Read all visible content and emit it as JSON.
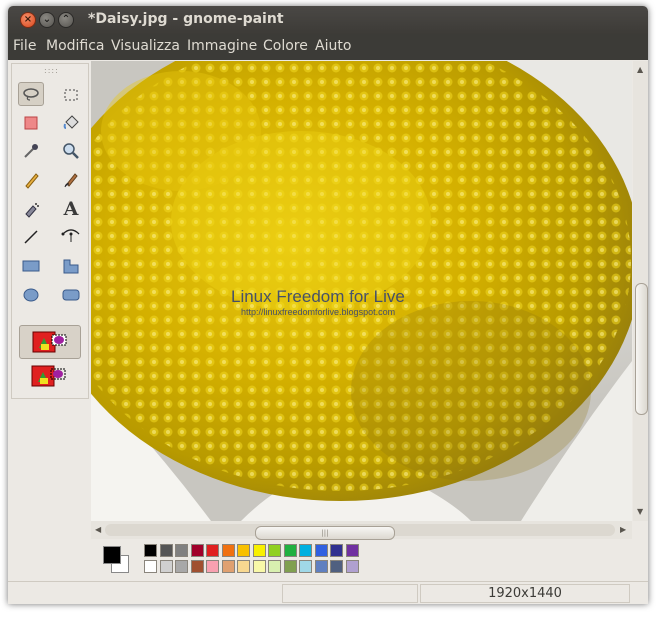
{
  "window": {
    "title": "*Daisy.jpg - gnome-paint",
    "buttons": {
      "close": "×",
      "minimize": "⌄",
      "maximize": "⌃"
    }
  },
  "menu": [
    "File",
    "Modifica",
    "Visualizza",
    "Immagine",
    "Colore",
    "Aiuto"
  ],
  "tools": [
    {
      "name": "lasso-select-icon",
      "glyph": "⟳",
      "active": true
    },
    {
      "name": "rect-select-icon",
      "glyph": "⬚"
    },
    {
      "name": "eraser-icon",
      "glyph": "■"
    },
    {
      "name": "fill-bucket-icon",
      "glyph": "⛾"
    },
    {
      "name": "color-picker-icon",
      "glyph": "✎"
    },
    {
      "name": "zoom-icon",
      "glyph": "⌕"
    },
    {
      "name": "pencil-icon",
      "glyph": "✏"
    },
    {
      "name": "paintbrush-icon",
      "glyph": "🖌"
    },
    {
      "name": "airbrush-icon",
      "glyph": "✒"
    },
    {
      "name": "text-icon",
      "glyph": "A"
    },
    {
      "name": "line-icon",
      "glyph": "╱"
    },
    {
      "name": "curve-icon",
      "glyph": "⤻"
    },
    {
      "name": "rectangle-icon",
      "glyph": "▬"
    },
    {
      "name": "polygon-icon",
      "glyph": "⬒"
    },
    {
      "name": "ellipse-icon",
      "glyph": "⬬"
    },
    {
      "name": "rounded-rect-icon",
      "glyph": "▭"
    }
  ],
  "canvas": {
    "watermark_title": "Linux Freedom for Live",
    "watermark_url": "http://linuxfreedomforlive.blogspot.com"
  },
  "palette": {
    "foreground": "#000000",
    "background": "#ffffff",
    "row1": [
      "#000000",
      "#555555",
      "#808080",
      "#a0002a",
      "#e02020",
      "#f07010",
      "#f8c000",
      "#f8f000",
      "#90d020",
      "#20b040",
      "#00b0e0",
      "#3060e0",
      "#303090",
      "#7030a0"
    ],
    "row2": [
      "#ffffff",
      "#d0d0d0",
      "#a8a8a8",
      "#a05030",
      "#f8a0b0",
      "#e0a070",
      "#f8d890",
      "#f8f8a8",
      "#d8f0b0",
      "#80a050",
      "#a0d8e8",
      "#6080c0",
      "#506080",
      "#b0a0d0"
    ]
  },
  "status": {
    "cell1": "",
    "cell2": "",
    "dimensions": "1920x1440"
  },
  "scroll": {
    "grip": "|||"
  }
}
